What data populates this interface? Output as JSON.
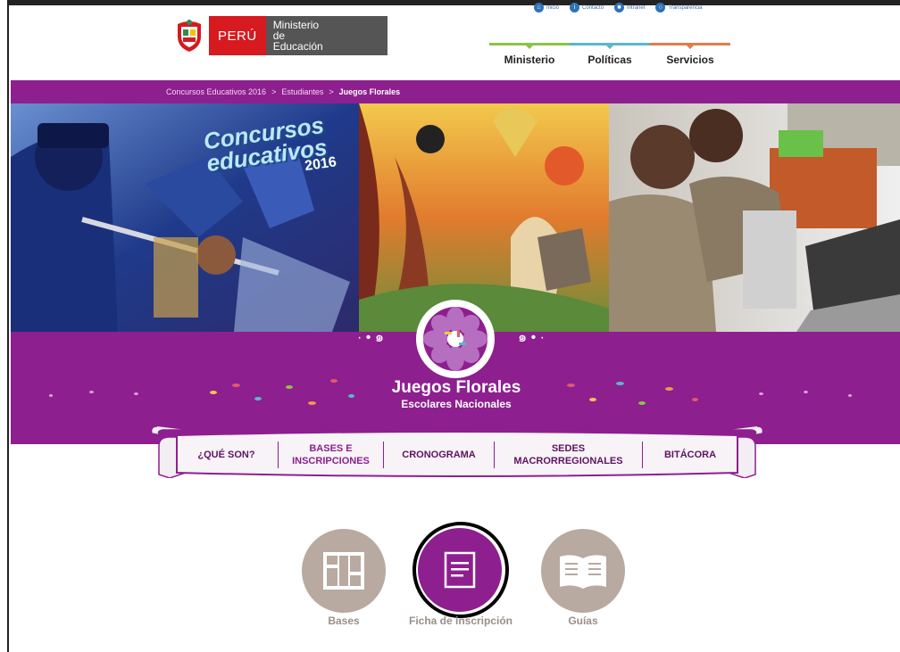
{
  "header": {
    "country": "PERÚ",
    "ministry_line1": "Ministerio",
    "ministry_line2": "de Educación",
    "top_links": [
      "Inicio",
      "Contacto",
      "Intranet",
      "Transparencia"
    ],
    "nav": [
      "Ministerio",
      "Políticas",
      "Servicios"
    ]
  },
  "breadcrumb": {
    "items": [
      "Concursos Educativos 2016",
      "Estudiantes"
    ],
    "separator": ">",
    "current": "Juegos Florales"
  },
  "hero": {
    "badge_line1": "Concursos",
    "badge_line2": "educativos",
    "badge_year": "2016"
  },
  "title": {
    "main": "Juegos Florales",
    "sub": "Escolares Nacionales"
  },
  "menu": [
    {
      "line1": "¿QUÉ SON?",
      "line2": ""
    },
    {
      "line1": "BASES E",
      "line2": "INSCRIPCIONES"
    },
    {
      "line1": "CRONOGRAMA",
      "line2": ""
    },
    {
      "line1": "SEDES",
      "line2": "MACRORREGIONALES"
    },
    {
      "line1": "BITÁCORA",
      "line2": ""
    }
  ],
  "resources": {
    "bases": "Bases",
    "ficha": "Ficha de inscripción",
    "guias": "Guías"
  },
  "colors": {
    "brand_purple": "#8e1f8f",
    "peru_red": "#d71920",
    "icon_gray": "#b8a9a1"
  }
}
